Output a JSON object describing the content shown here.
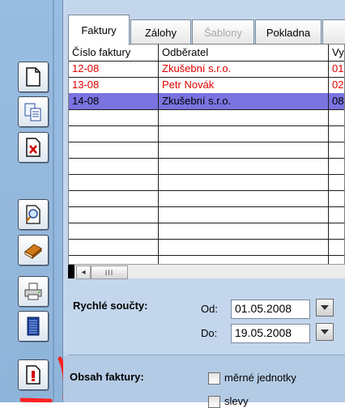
{
  "tabs": [
    {
      "label": "Faktury",
      "state": "active"
    },
    {
      "label": "Zálohy",
      "state": "normal"
    },
    {
      "label": "Šablony",
      "state": "disabled"
    },
    {
      "label": "Pokladna",
      "state": "normal"
    }
  ],
  "table": {
    "columns": [
      "Číslo faktury",
      "Odběratel",
      "Vy"
    ],
    "rows": [
      {
        "number": "12-08",
        "customer": "Zkušební s.r.o.",
        "extra": "01",
        "style": "red"
      },
      {
        "number": "13-08",
        "customer": "Petr Novák",
        "extra": "02",
        "style": "red"
      },
      {
        "number": "14-08",
        "customer": "Zkušební s.r.o.",
        "extra": "08",
        "style": "selected"
      }
    ],
    "empty_rows": 7
  },
  "scrollbar": {
    "left_arrow": "◂",
    "thumb_grip": "III"
  },
  "quick_sums": {
    "title": "Rychlé součty:",
    "from_label": "Od:",
    "from_value": "01.05.2008",
    "to_label": "Do:",
    "to_value": "19.05.2008"
  },
  "invoice_content": {
    "title": "Obsah faktury:",
    "options": [
      {
        "label": "měrné jednotky",
        "checked": false
      },
      {
        "label": "slevy",
        "checked": false
      }
    ]
  },
  "toolbar": {
    "buttons": [
      "new-document-icon",
      "copy-document-icon",
      "delete-document-icon",
      "preview-icon",
      "book-icon",
      "print-icon",
      "list-icon",
      "document-alert-icon"
    ]
  },
  "colors": {
    "red_text": "#e00000",
    "selection": "#7a73e0",
    "panel": "#c3d6ec",
    "toolbar": "#93b8dd"
  }
}
